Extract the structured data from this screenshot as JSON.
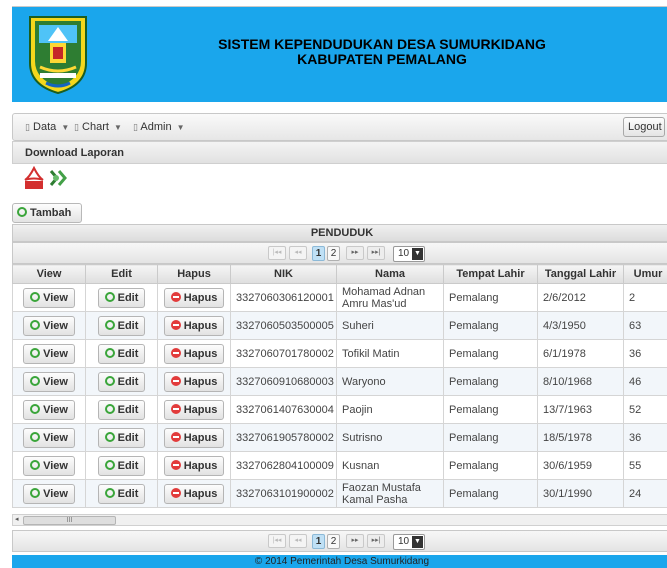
{
  "header": {
    "title_line1": "SISTEM KEPENDUDUKAN DESA SUMURKIDANG",
    "title_line2": "KABUPATEN PEMALANG"
  },
  "menu": {
    "items": [
      {
        "label": "Data"
      },
      {
        "label": "Chart"
      },
      {
        "label": "Admin"
      }
    ],
    "logout_label": "Logout"
  },
  "download": {
    "title": "Download Laporan"
  },
  "toolbar": {
    "add_label": "Tambah"
  },
  "grid": {
    "title": "PENDUDUK",
    "columns": [
      "View",
      "Edit",
      "Hapus",
      "NIK",
      "Nama",
      "Tempat Lahir",
      "Tanggal Lahir",
      "Umur"
    ],
    "view_label": "View",
    "edit_label": "Edit",
    "delete_label": "Hapus",
    "rows": [
      {
        "nik": "3327060306120001",
        "nama": "Mohamad Adnan Amru Mas'ud",
        "tempat": "Pemalang",
        "tanggal": "2/6/2012",
        "umur": "2"
      },
      {
        "nik": "3327060503500005",
        "nama": "Suheri",
        "tempat": "Pemalang",
        "tanggal": "4/3/1950",
        "umur": "63"
      },
      {
        "nik": "3327060701780002",
        "nama": "Tofikil Matin",
        "tempat": "Pemalang",
        "tanggal": "6/1/1978",
        "umur": "36"
      },
      {
        "nik": "3327060910680003",
        "nama": "Waryono",
        "tempat": "Pemalang",
        "tanggal": "8/10/1968",
        "umur": "46"
      },
      {
        "nik": "3327061407630004",
        "nama": "Paojin",
        "tempat": "Pemalang",
        "tanggal": "13/7/1963",
        "umur": "52"
      },
      {
        "nik": "3327061905780002",
        "nama": "Sutrisno",
        "tempat": "Pemalang",
        "tanggal": "18/5/1978",
        "umur": "36"
      },
      {
        "nik": "3327062804100009",
        "nama": "Kusnan",
        "tempat": "Pemalang",
        "tanggal": "30/6/1959",
        "umur": "55"
      },
      {
        "nik": "3327063101900002",
        "nama": "Faozan Mustafa Kamal Pasha",
        "tempat": "Pemalang",
        "tanggal": "30/1/1990",
        "umur": "24"
      }
    ]
  },
  "pager": {
    "pages": [
      "1",
      "2"
    ],
    "current_page": "1",
    "rows_per_page": "10"
  },
  "scrollbar": {
    "thumb_grip": "III"
  },
  "footer": {
    "text": "© 2014 Pemerintah Desa Sumurkidang"
  },
  "colors": {
    "header_bg": "#1aa6ec",
    "footer_bg": "#1aa6ec",
    "add_icon": "#3aa53a",
    "delete_icon": "#e23b3b"
  },
  "icons": [
    "logo-emblem",
    "document-icon",
    "chevron-down-icon",
    "pdf-icon",
    "excel-icon",
    "plus-circle-icon",
    "minus-circle-icon"
  ]
}
